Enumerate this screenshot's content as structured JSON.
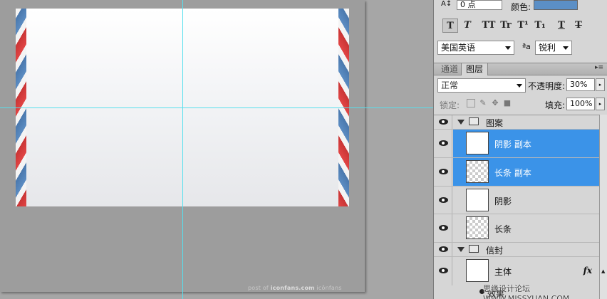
{
  "canvas": {
    "watermark_prefix": "post of",
    "watermark_site": "iconfans.com",
    "watermark_brand": "icônfans"
  },
  "character_panel": {
    "size_value": "0 点",
    "color_label": "颜色:",
    "color_swatch": "#5b8fc6",
    "format_buttons": [
      "T",
      "T",
      "TT",
      "Tr",
      "T¹",
      "T₁",
      "T",
      "T"
    ],
    "language": "美国英语",
    "aa_label": "ªa",
    "antialias": "锐利"
  },
  "layers_panel": {
    "tabs": [
      "通道",
      "图层"
    ],
    "blend_mode": "正常",
    "opacity_label": "不透明度:",
    "opacity_value": "30%",
    "lock_label": "锁定:",
    "fill_label": "填充:",
    "fill_value": "100%",
    "layers": [
      {
        "name": "图案",
        "type": "group"
      },
      {
        "name": "阴影 副本",
        "type": "layer",
        "selected": true
      },
      {
        "name": "长条 副本",
        "type": "layer",
        "selected": true
      },
      {
        "name": "阴影",
        "type": "layer"
      },
      {
        "name": "长条",
        "type": "layer"
      },
      {
        "name": "信封",
        "type": "group"
      },
      {
        "name": "主体",
        "type": "layer",
        "fx": "fx"
      }
    ],
    "effect_label": "效果"
  },
  "site_mark": "思缘设计论坛 WWW.MISSYUAN.COM",
  "colors": {
    "selection": "#3b93e8",
    "guide": "#56e0ee",
    "stripe_red": "#e24545",
    "stripe_blue": "#5c8dc3"
  }
}
